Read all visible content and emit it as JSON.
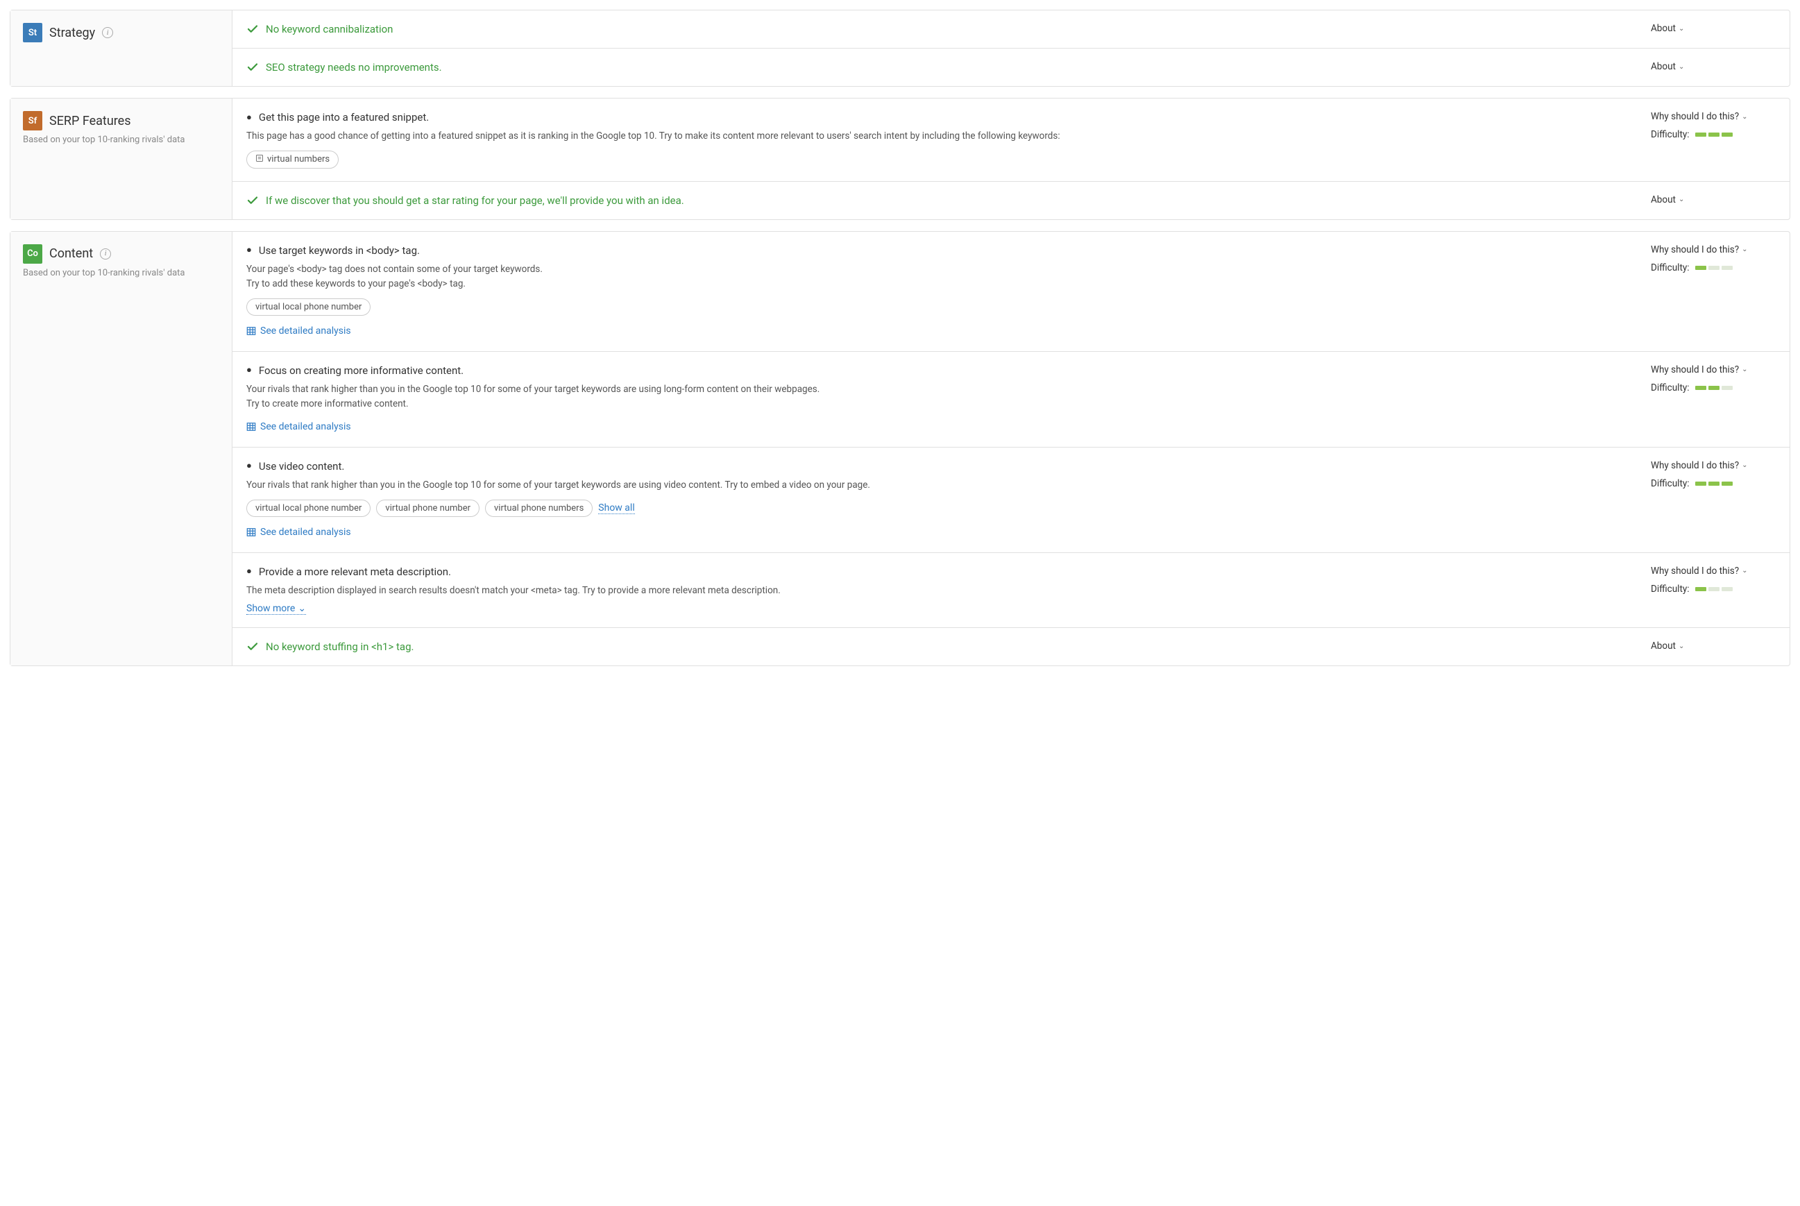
{
  "common": {
    "why_label": "Why should I do this?",
    "about_label": "About",
    "difficulty_label": "Difficulty:",
    "see_detailed": "See detailed analysis",
    "show_all": "Show all",
    "show_more": "Show more"
  },
  "sections": {
    "strategy": {
      "badge": "St",
      "title": "Strategy",
      "rows": [
        {
          "type": "success",
          "title": "No keyword cannibalization",
          "side": "about"
        },
        {
          "type": "success",
          "title": "SEO strategy needs no improvements.",
          "side": "about"
        }
      ]
    },
    "serp": {
      "badge": "Sf",
      "title": "SERP Features",
      "subtitle": "Based on your top 10-ranking rivals' data",
      "rows": [
        {
          "type": "task",
          "title": "Get this page into a featured snippet.",
          "desc": "This page has a good chance of getting into a featured snippet as it is ranking in the Google top 10. Try to make its content more relevant to users' search intent by including the following keywords:",
          "pills": [
            {
              "icon": true,
              "text": "virtual numbers"
            }
          ],
          "side": "why",
          "difficulty": 3
        },
        {
          "type": "success",
          "title": "If we discover that you should get a star rating for your page, we'll provide you with an idea.",
          "side": "about"
        }
      ]
    },
    "content": {
      "badge": "Co",
      "title": "Content",
      "subtitle": "Based on your top 10-ranking rivals' data",
      "rows": [
        {
          "type": "task",
          "title": "Use target keywords in <body> tag.",
          "desc": "Your page's <body> tag does not contain some of your target keywords.\nTry to add these keywords to your page's <body> tag.",
          "pills": [
            {
              "text": "virtual local phone number"
            }
          ],
          "detailed": true,
          "side": "why",
          "difficulty": 1
        },
        {
          "type": "task",
          "title": "Focus on creating more informative content.",
          "desc": "Your rivals that rank higher than you in the Google top 10 for some of your target keywords are using long-form content on their webpages.\nTry to create more informative content.",
          "detailed": true,
          "side": "why",
          "difficulty": 2
        },
        {
          "type": "task",
          "title": "Use video content.",
          "desc": "Your rivals that rank higher than you in the Google top 10 for some of your target keywords are using video content. Try to embed a video on your page.",
          "pills": [
            {
              "text": "virtual local phone number"
            },
            {
              "text": "virtual phone number"
            },
            {
              "text": "virtual phone numbers"
            }
          ],
          "show_all": true,
          "detailed": true,
          "side": "why",
          "difficulty": 3
        },
        {
          "type": "task",
          "title": "Provide a more relevant meta description.",
          "desc": "The meta description displayed in search results doesn't match your <meta> tag. Try to provide a more relevant meta description.",
          "show_more": true,
          "side": "why",
          "difficulty": 1
        },
        {
          "type": "success",
          "title": "No keyword stuffing in <h1> tag.",
          "side": "about"
        }
      ]
    }
  }
}
